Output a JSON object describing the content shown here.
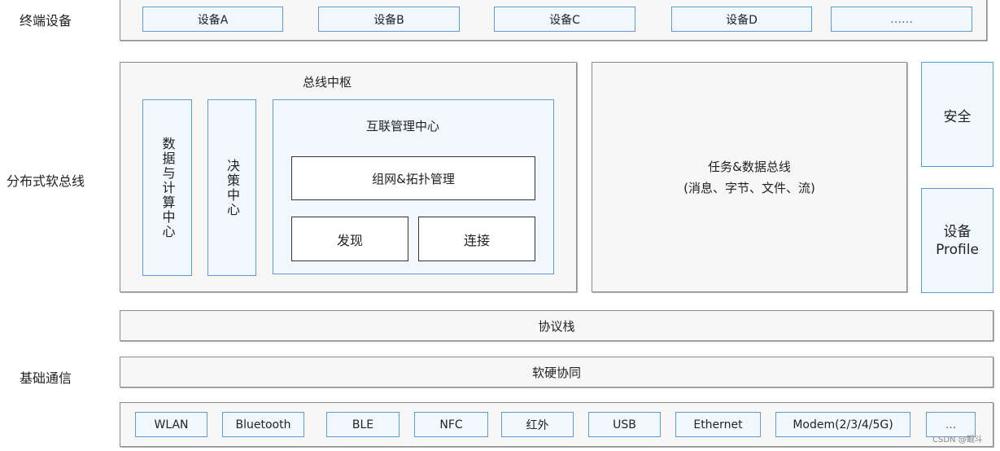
{
  "row_labels": {
    "terminal": "终端设备",
    "softbus": "分布式软总线",
    "basic_comm": "基础通信"
  },
  "devices": [
    "设备A",
    "设备B",
    "设备C",
    "设备D",
    "……"
  ],
  "bus_hub": {
    "title": "总线中枢",
    "data_compute_center": "数据与计算中心",
    "decision_center": "决策中心",
    "interconnect": {
      "title": "互联管理中心",
      "networking": "组网&拓扑管理",
      "discovery": "发现",
      "connection": "连接"
    }
  },
  "task_data_bus": {
    "line1": "任务&数据总线",
    "line2": "(消息、字节、文件、流)"
  },
  "security": "安全",
  "device_profile": {
    "line1": "设备",
    "line2": "Profile"
  },
  "protocol_stack": "协议栈",
  "hw_sw_coop": "软硬协同",
  "transports": [
    "WLAN",
    "Bluetooth",
    "BLE",
    "NFC",
    "红外",
    "USB",
    "Ethernet",
    "Modem(2/3/4/5G)",
    "..."
  ],
  "watermark": "CSDN @鲲斗"
}
